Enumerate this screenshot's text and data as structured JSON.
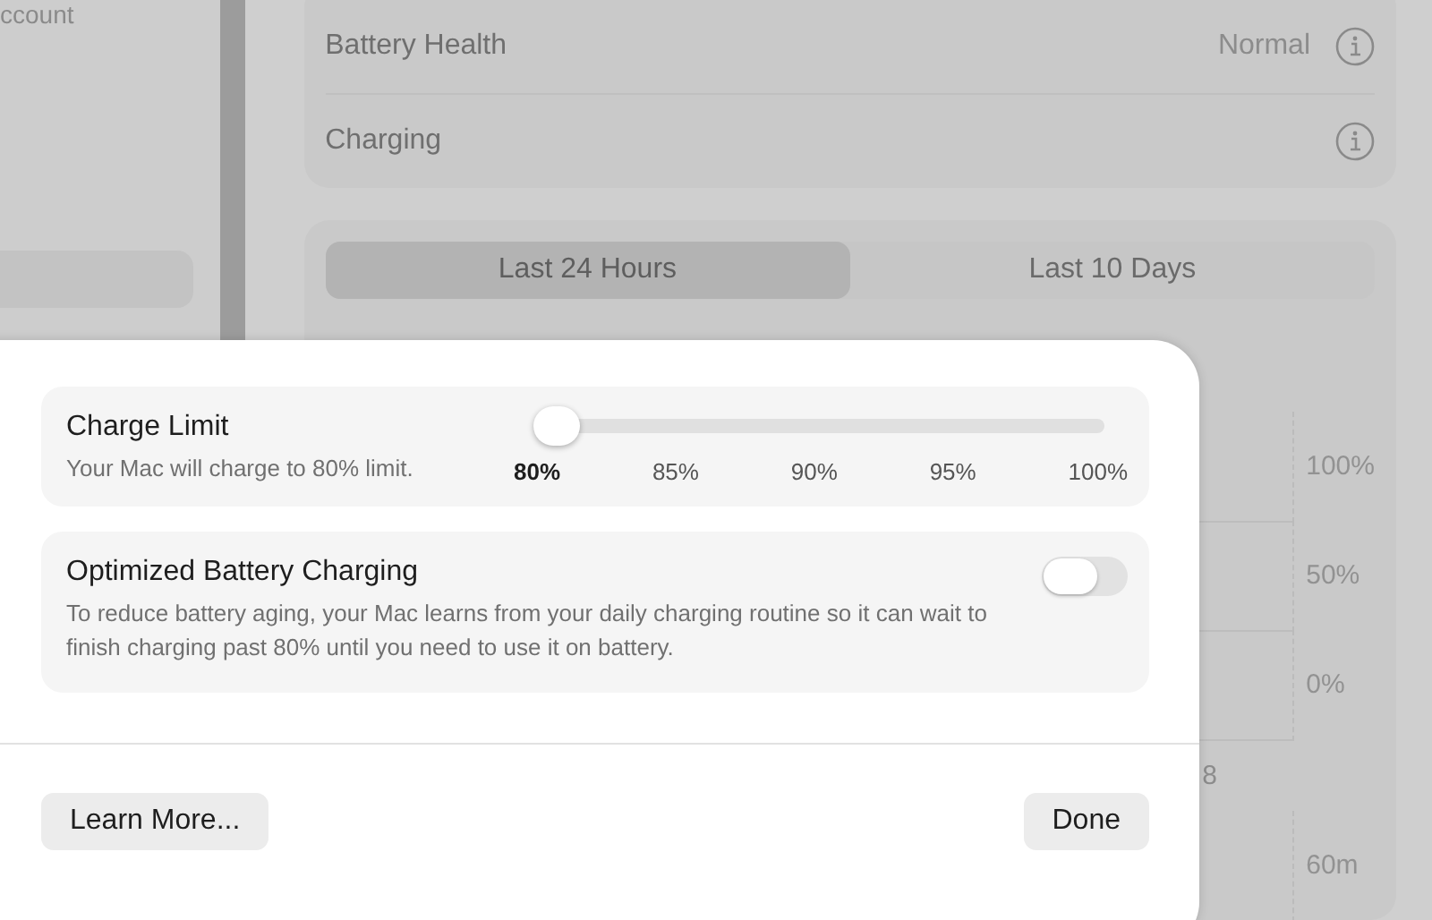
{
  "sidebar": {
    "items": [
      {
        "label": "ccount",
        "selected": false
      },
      {
        "selected": true
      }
    ]
  },
  "battery": {
    "rows": [
      {
        "label": "Battery Health",
        "value": "Normal"
      },
      {
        "label": "Charging"
      }
    ]
  },
  "tabs": [
    {
      "label": "Last 24 Hours",
      "selected": true
    },
    {
      "label": "Last 10 Days",
      "selected": false
    }
  ],
  "chart": {
    "level_labels": [
      "100%",
      "50%",
      "0%"
    ],
    "time_label": "8",
    "usage_labels": [
      "60m"
    ]
  },
  "sheet": {
    "charge_limit": {
      "title": "Charge Limit",
      "description": "Your Mac will charge to 80% limit.",
      "level": 0,
      "ticks": [
        {
          "label": "80%",
          "selected": true
        },
        {
          "label": "85%",
          "selected": false
        },
        {
          "label": "90%",
          "selected": false
        },
        {
          "label": "95%",
          "selected": false
        },
        {
          "label": "100%",
          "selected": false
        }
      ]
    },
    "optimized": {
      "title": "Optimized Battery Charging",
      "description": "To reduce battery aging, your Mac learns from your daily charging routine so it can wait to finish charging past 80% until you need to use it on battery.",
      "on": false
    },
    "buttons": [
      "Learn More...",
      "Done"
    ]
  }
}
